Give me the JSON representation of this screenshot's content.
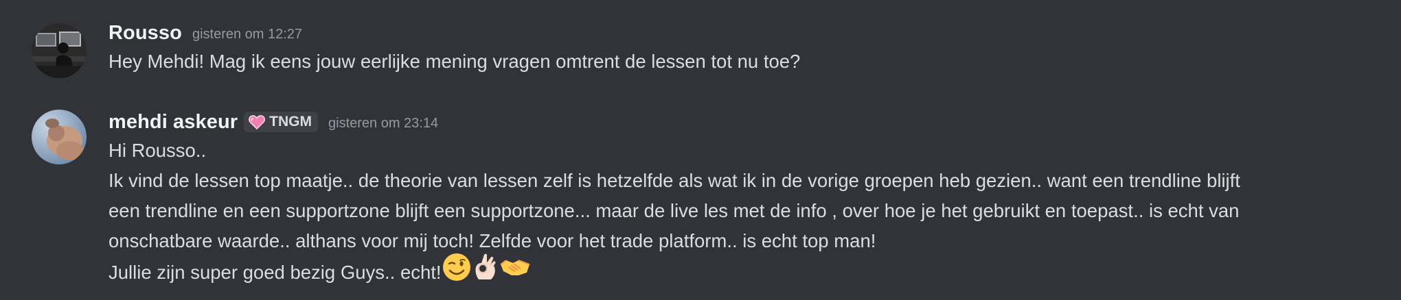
{
  "messages": [
    {
      "author": "Rousso",
      "timestamp": "gisteren om 12:27",
      "avatar": "avatar-rousso",
      "lines": [
        "Hey Mehdi! Mag ik eens jouw eerlijke mening vragen omtrent de lessen tot nu toe?"
      ]
    },
    {
      "author": "mehdi askeur",
      "role_tag": {
        "icon": "pink-heart-icon",
        "label": "TNGM"
      },
      "timestamp": "gisteren om 23:14",
      "avatar": "avatar-mehdi",
      "lines": [
        "Hi Rousso..",
        "Ik vind de lessen top maatje..  de theorie van lessen zelf is hetzelfde als wat ik in de vorige groepen heb gezien.. want een trendline blijft",
        "een trendline en een supportzone blijft een supportzone... maar de live les met de info , over hoe je het gebruikt en toepast.. is echt van",
        "onschatbare waarde.. althans voor mij toch! Zelfde voor het trade platform.. is echt top man!",
        "Jullie zijn super goed bezig Guys.. echt!"
      ],
      "trailing_emojis": [
        "winking-face-emoji",
        "ok-hand-emoji",
        "handshake-emoji"
      ]
    }
  ],
  "colors": {
    "background": "#313338",
    "username": "#f2f3f5",
    "text": "#dbdee1",
    "timestamp": "#949ba4",
    "role_tag_bg": "#3f4147"
  }
}
